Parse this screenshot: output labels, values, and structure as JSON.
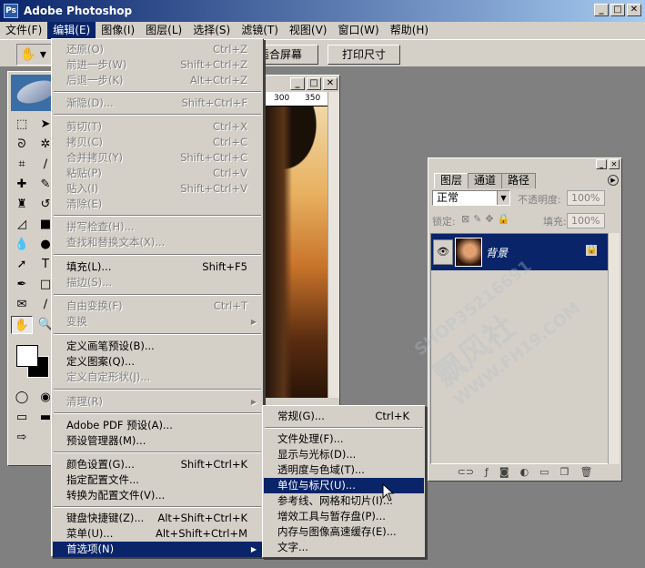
{
  "app": {
    "title": "Adobe Photoshop",
    "logo_text": "Ps",
    "window_buttons": [
      "_",
      "□",
      "✕"
    ]
  },
  "menubar": [
    {
      "label": "文件(F)"
    },
    {
      "label": "编辑(E)"
    },
    {
      "label": "图像(I)"
    },
    {
      "label": "图层(L)"
    },
    {
      "label": "选择(S)"
    },
    {
      "label": "滤镜(T)"
    },
    {
      "label": "视图(V)"
    },
    {
      "label": "窗口(W)"
    },
    {
      "label": "帮助(H)"
    }
  ],
  "options_bar": {
    "tool_icon": "✋",
    "fit_screen_label": "适合屏幕",
    "print_size_label": "打印尺寸"
  },
  "doc_window": {
    "ruler_marks": [
      "300",
      "350"
    ],
    "window_buttons": [
      "_",
      "□",
      "✕"
    ]
  },
  "layers_panel": {
    "tabs": [
      "图层",
      "通道",
      "路径"
    ],
    "blend_mode": "正常",
    "opacity_label": "不透明度:",
    "opacity_value": "100%",
    "lock_label": "锁定:",
    "fill_label": "填充:",
    "fill_value": "100%",
    "layer_name": "背景",
    "window_buttons": [
      "_",
      "✕"
    ]
  },
  "edit_menu": {
    "items": [
      {
        "label": "还原(O)",
        "shortcut": "Ctrl+Z",
        "disabled": true
      },
      {
        "label": "前进一步(W)",
        "shortcut": "Shift+Ctrl+Z",
        "disabled": true
      },
      {
        "label": "后退一步(K)",
        "shortcut": "Alt+Ctrl+Z",
        "disabled": true
      },
      {
        "label": "渐隐(D)...",
        "shortcut": "Shift+Ctrl+F",
        "disabled": true
      },
      {
        "label": "剪切(T)",
        "shortcut": "Ctrl+X",
        "disabled": true
      },
      {
        "label": "拷贝(C)",
        "shortcut": "Ctrl+C",
        "disabled": true
      },
      {
        "label": "合并拷贝(Y)",
        "shortcut": "Shift+Ctrl+C",
        "disabled": true
      },
      {
        "label": "粘贴(P)",
        "shortcut": "Ctrl+V",
        "disabled": true
      },
      {
        "label": "贴入(I)",
        "shortcut": "Shift+Ctrl+V",
        "disabled": true
      },
      {
        "label": "清除(E)",
        "shortcut": "",
        "disabled": true
      },
      {
        "label": "拼写检查(H)...",
        "shortcut": "",
        "disabled": true
      },
      {
        "label": "查找和替换文本(X)...",
        "shortcut": "",
        "disabled": true
      },
      {
        "label": "填充(L)...",
        "shortcut": "Shift+F5",
        "disabled": false
      },
      {
        "label": "描边(S)...",
        "shortcut": "",
        "disabled": true
      },
      {
        "label": "自由变换(F)",
        "shortcut": "Ctrl+T",
        "disabled": true
      },
      {
        "label": "变换",
        "shortcut": "",
        "disabled": true,
        "submenu": true
      },
      {
        "label": "定义画笔预设(B)...",
        "shortcut": "",
        "disabled": false
      },
      {
        "label": "定义图案(Q)...",
        "shortcut": "",
        "disabled": false
      },
      {
        "label": "定义自定形状(J)...",
        "shortcut": "",
        "disabled": true
      },
      {
        "label": "清理(R)",
        "shortcut": "",
        "disabled": true,
        "submenu": true
      },
      {
        "label": "Adobe PDF 预设(A)...",
        "shortcut": "",
        "disabled": false
      },
      {
        "label": "预设管理器(M)...",
        "shortcut": "",
        "disabled": false
      },
      {
        "label": "颜色设置(G)...",
        "shortcut": "Shift+Ctrl+K",
        "disabled": false
      },
      {
        "label": "指定配置文件...",
        "shortcut": "",
        "disabled": false
      },
      {
        "label": "转换为配置文件(V)...",
        "shortcut": "",
        "disabled": false
      },
      {
        "label": "键盘快捷键(Z)...",
        "shortcut": "Alt+Shift+Ctrl+K",
        "disabled": false
      },
      {
        "label": "菜单(U)...",
        "shortcut": "Alt+Shift+Ctrl+M",
        "disabled": false
      },
      {
        "label": "首选项(N)",
        "shortcut": "",
        "disabled": false,
        "submenu": true,
        "highlighted": true
      }
    ]
  },
  "preferences_submenu": {
    "items": [
      {
        "label": "常规(G)...",
        "shortcut": "Ctrl+K"
      },
      {
        "label": "文件处理(F)...",
        "shortcut": ""
      },
      {
        "label": "显示与光标(D)...",
        "shortcut": ""
      },
      {
        "label": "透明度与色域(T)...",
        "shortcut": ""
      },
      {
        "label": "单位与标尺(U)...",
        "shortcut": "",
        "highlighted": true
      },
      {
        "label": "参考线、网格和切片(I)...",
        "shortcut": ""
      },
      {
        "label": "增效工具与暂存盘(P)...",
        "shortcut": ""
      },
      {
        "label": "内存与图像高速缓存(E)...",
        "shortcut": ""
      },
      {
        "label": "文字...",
        "shortcut": ""
      }
    ]
  },
  "watermark": {
    "line1": "SHOP35216691",
    "line2": "飘风社",
    "line3": "WWW.FH19.COM"
  }
}
